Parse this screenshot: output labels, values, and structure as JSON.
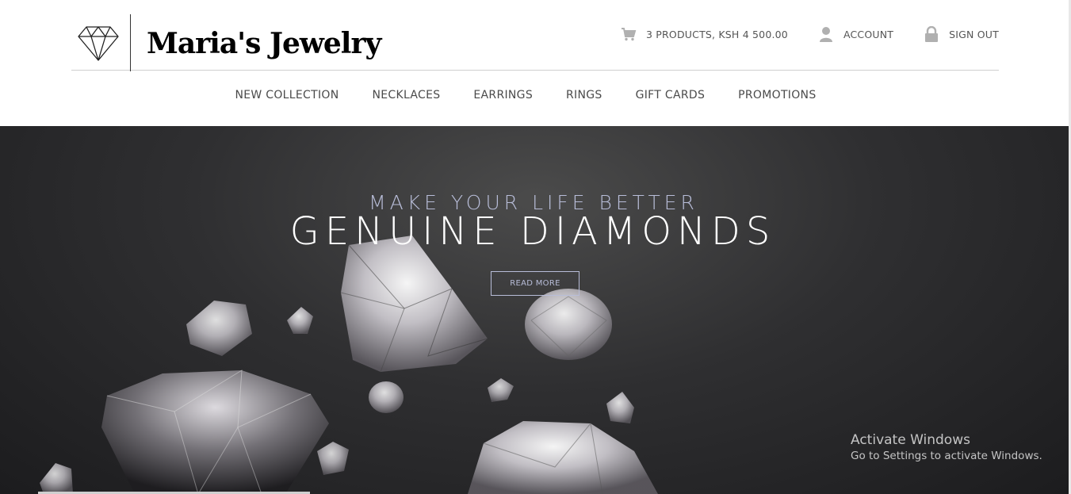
{
  "brand": {
    "name": "Maria's Jewelry",
    "logo_icon": "diamond-outline-icon"
  },
  "topbar": {
    "cart": {
      "icon": "cart-icon",
      "label": "3 PRODUCTS, KSH 4 500.00"
    },
    "account": {
      "icon": "user-icon",
      "label": "ACCOUNT"
    },
    "signout": {
      "icon": "lock-icon",
      "label": "SIGN OUT"
    }
  },
  "nav": {
    "items": [
      {
        "label": "NEW COLLECTION"
      },
      {
        "label": "NECKLACES"
      },
      {
        "label": "EARRINGS"
      },
      {
        "label": "RINGS"
      },
      {
        "label": "GIFT CARDS"
      },
      {
        "label": "PROMOTIONS"
      }
    ]
  },
  "hero": {
    "kicker": "MAKE YOUR LIFE BETTER",
    "title": "GENUINE DIAMONDS",
    "button_label": "READ MORE",
    "accent": "#b8bdd8"
  },
  "watermark": {
    "title": "Activate Windows",
    "subtitle": "Go to Settings to activate Windows."
  }
}
